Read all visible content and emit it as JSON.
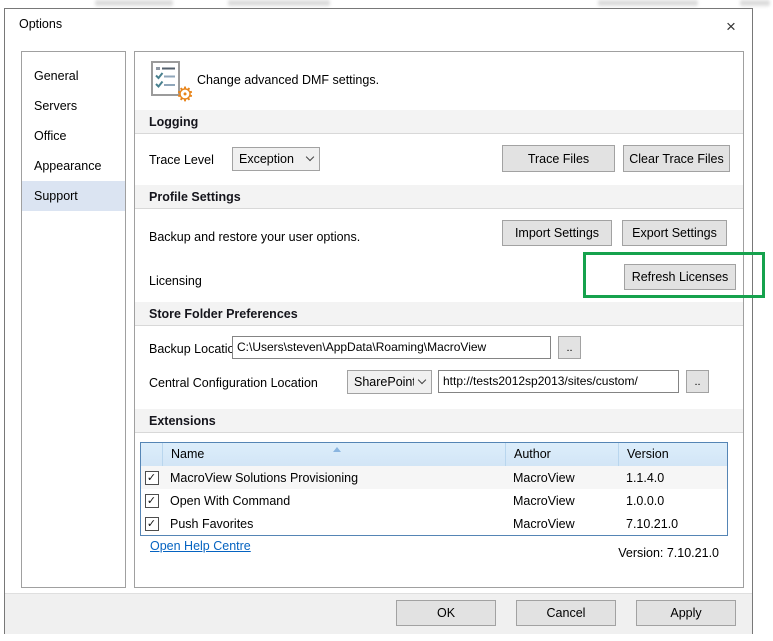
{
  "window": {
    "title": "Options"
  },
  "icons": {
    "close_glyph": "×",
    "gear_glyph": "⚙",
    "checkbox_checked_glyph": "✓"
  },
  "sidebar": {
    "items": [
      {
        "label": "General",
        "selected": false
      },
      {
        "label": "Servers",
        "selected": false
      },
      {
        "label": "Office",
        "selected": false
      },
      {
        "label": "Appearance",
        "selected": false
      },
      {
        "label": "Support",
        "selected": true
      }
    ]
  },
  "header": {
    "description": "Change advanced DMF settings."
  },
  "logging": {
    "title": "Logging",
    "trace_level_label": "Trace Level",
    "trace_level_value": "Exception",
    "trace_files_button": "Trace Files",
    "clear_trace_files_button": "Clear Trace Files"
  },
  "profile_settings": {
    "title": "Profile Settings",
    "backup_restore_label": "Backup and restore your user options.",
    "import_button": "Import Settings",
    "export_button": "Export Settings",
    "licensing_label": "Licensing",
    "refresh_licenses_button": "Refresh Licenses"
  },
  "store_folder": {
    "title": "Store Folder Preferences",
    "backup_location_label": "Backup Location",
    "backup_location_value": "C:\\Users\\steven\\AppData\\Roaming\\MacroView",
    "backup_browse_button": "..",
    "central_config_label": "Central Configuration Location",
    "central_config_type": "SharePoint",
    "central_config_url": "http://tests2012sp2013/sites/custom/",
    "central_browse_button": ".."
  },
  "extensions": {
    "title": "Extensions",
    "columns": {
      "name": "Name",
      "author": "Author",
      "version": "Version"
    },
    "rows": [
      {
        "checked": true,
        "name": "MacroView Solutions Provisioning",
        "author": "MacroView",
        "version": "1.1.4.0"
      },
      {
        "checked": true,
        "name": "Open With Command",
        "author": "MacroView",
        "version": "1.0.0.0"
      },
      {
        "checked": true,
        "name": "Push Favorites",
        "author": "MacroView",
        "version": "7.10.21.0"
      }
    ],
    "help_link": "Open Help Centre",
    "version_text": "Version: 7.10.21.0"
  },
  "footer": {
    "ok_button": "OK",
    "cancel_button": "Cancel",
    "apply_button": "Apply"
  },
  "colors": {
    "highlight_green": "#16a24d",
    "link_blue": "#0563c1",
    "selected_nav_bg": "#dbe4f2",
    "table_header_blue": "#d9eafa",
    "gear_orange": "#e8851c"
  }
}
